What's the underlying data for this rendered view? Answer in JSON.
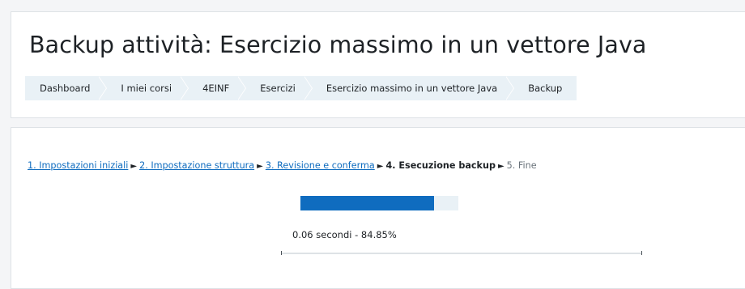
{
  "page": {
    "title": "Backup attività: Esercizio massimo in un vettore Java"
  },
  "breadcrumb": [
    {
      "label": "Dashboard"
    },
    {
      "label": "I miei corsi"
    },
    {
      "label": "4EINF"
    },
    {
      "label": "Esercizi"
    },
    {
      "label": "Esercizio massimo in un vettore Java"
    },
    {
      "label": "Backup"
    }
  ],
  "steps": {
    "step1": "1. Impostazioni iniziali",
    "step2": "2. Impostazione struttura",
    "step3": "3. Revisione e conferma",
    "step4": "4. Esecuzione backup",
    "step5": "5. Fine",
    "separator": "►"
  },
  "progress": {
    "percent": 84.85,
    "text": "0.06 secondi - 84.85%"
  },
  "colors": {
    "accent": "#0f6cbf",
    "track": "#e9f1f6"
  }
}
